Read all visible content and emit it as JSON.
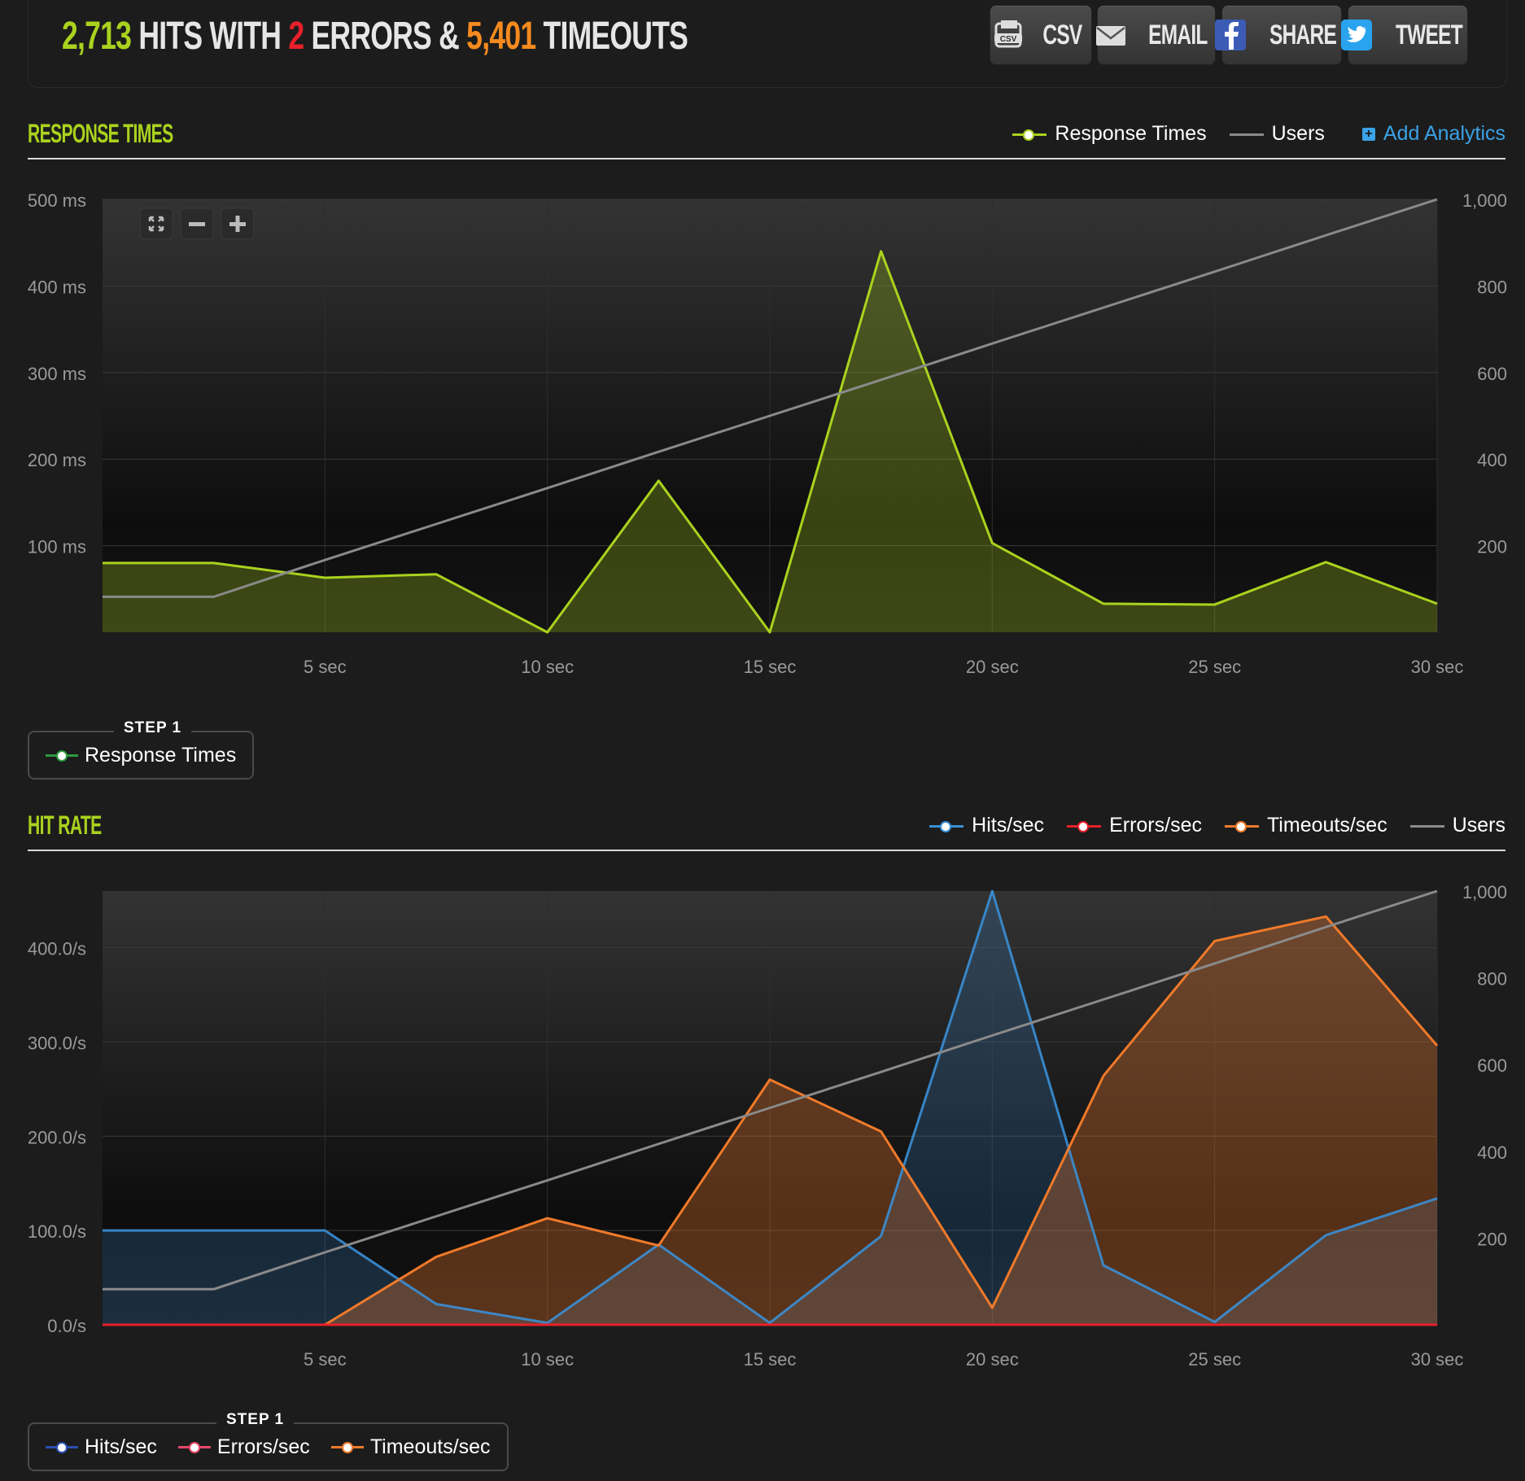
{
  "summary": {
    "hits": "2,713",
    "hits_text": "HITS WITH",
    "errors": "2",
    "errors_text": "ERRORS &",
    "timeouts": "5,401",
    "timeouts_text": "TIMEOUTS"
  },
  "share_buttons": [
    {
      "label": "CSV",
      "icon": "csv-icon"
    },
    {
      "label": "EMAIL",
      "icon": "email-icon"
    },
    {
      "label": "SHARE",
      "icon": "facebook-icon"
    },
    {
      "label": "TWEET",
      "icon": "twitter-icon"
    }
  ],
  "response_section": {
    "title": "RESPONSE TIMES",
    "legend": {
      "response": "Response Times",
      "users": "Users",
      "add_analytics": "Add Analytics"
    },
    "step_label": "STEP 1",
    "step_items": [
      "Response Times"
    ]
  },
  "hitrate_section": {
    "title": "HIT RATE",
    "legend": {
      "hits": "Hits/sec",
      "errors": "Errors/sec",
      "timeouts": "Timeouts/sec",
      "users": "Users"
    },
    "step_label": "STEP 1",
    "step_items": [
      "Hits/sec",
      "Errors/sec",
      "Timeouts/sec"
    ]
  },
  "colors": {
    "response": "#aad21e",
    "users": "#8a8a8a",
    "hits": "#3a8fd6",
    "errors": "#e8202a",
    "timeouts": "#f07a2a",
    "step_response": "#2e9a3e",
    "step_hits": "#2b4fb0",
    "step_errors": "#e8466a"
  },
  "chart_data": [
    {
      "type": "area",
      "x": [
        0,
        2.5,
        5,
        7.5,
        10,
        12.5,
        15,
        17.5,
        20,
        22.5,
        25,
        27.5,
        30
      ],
      "x_ticks": [
        "5 sec",
        "10 sec",
        "15 sec",
        "20 sec",
        "25 sec",
        "30 sec"
      ],
      "x_tick_values": [
        5,
        10,
        15,
        20,
        25,
        30
      ],
      "xlim": [
        0,
        30
      ],
      "ylim": [
        0,
        500
      ],
      "y_ticks": [
        "100 ms",
        "200 ms",
        "300 ms",
        "400 ms",
        "500 ms"
      ],
      "y_tick_values": [
        100,
        200,
        300,
        400,
        500
      ],
      "y2lim": [
        0,
        1000
      ],
      "y2_ticks": [
        "200",
        "400",
        "600",
        "800",
        "1,000"
      ],
      "y2_tick_values": [
        200,
        400,
        600,
        800,
        1000
      ],
      "series": [
        {
          "name": "Response Times",
          "axis": "left",
          "values": [
            80,
            80,
            63,
            67,
            0,
            175,
            0,
            440,
            103,
            33,
            32,
            81,
            33
          ]
        },
        {
          "name": "Users",
          "axis": "right",
          "values": [
            82,
            82,
            167,
            250,
            333,
            417,
            500,
            583,
            667,
            750,
            833,
            917,
            1000
          ]
        }
      ]
    },
    {
      "type": "area",
      "x": [
        0,
        2.5,
        5,
        7.5,
        10,
        12.5,
        15,
        17.5,
        20,
        22.5,
        25,
        27.5,
        30
      ],
      "x_ticks": [
        "5 sec",
        "10 sec",
        "15 sec",
        "20 sec",
        "25 sec",
        "30 sec"
      ],
      "x_tick_values": [
        5,
        10,
        15,
        20,
        25,
        30
      ],
      "xlim": [
        0,
        30
      ],
      "ylim": [
        0,
        460
      ],
      "y_ticks": [
        "0.0/s",
        "100.0/s",
        "200.0/s",
        "300.0/s",
        "400.0/s"
      ],
      "y_tick_values": [
        0,
        100,
        200,
        300,
        400
      ],
      "y2lim": [
        0,
        1000
      ],
      "y2_ticks": [
        "200",
        "400",
        "600",
        "800",
        "1,000"
      ],
      "y2_tick_values": [
        200,
        400,
        600,
        800,
        1000
      ],
      "series": [
        {
          "name": "Hits/sec",
          "axis": "left",
          "values": [
            100,
            100,
            100,
            22,
            2,
            85,
            2,
            94,
            460,
            63,
            3,
            95,
            134
          ]
        },
        {
          "name": "Errors/sec",
          "axis": "left",
          "values": [
            0,
            0,
            0,
            0,
            0,
            0,
            0,
            0,
            0,
            0,
            0,
            0,
            0
          ]
        },
        {
          "name": "Timeouts/sec",
          "axis": "left",
          "values": [
            0,
            0,
            0,
            72,
            113,
            84,
            260,
            205,
            18,
            264,
            407,
            433,
            296
          ]
        },
        {
          "name": "Users",
          "axis": "right",
          "values": [
            82,
            82,
            167,
            250,
            333,
            417,
            500,
            583,
            667,
            750,
            833,
            917,
            1000
          ]
        }
      ]
    }
  ]
}
